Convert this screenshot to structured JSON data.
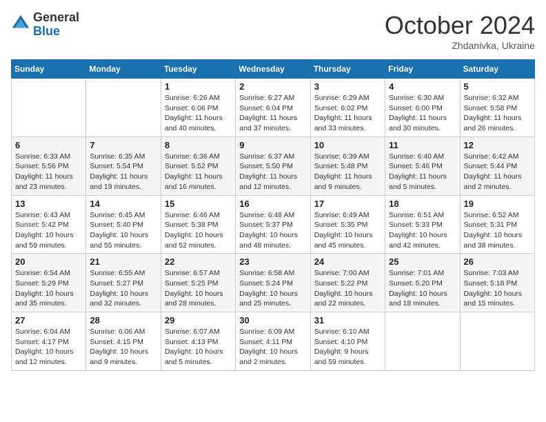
{
  "header": {
    "logo_general": "General",
    "logo_blue": "Blue",
    "month_title": "October 2024",
    "subtitle": "Zhdanivka, Ukraine"
  },
  "days_of_week": [
    "Sunday",
    "Monday",
    "Tuesday",
    "Wednesday",
    "Thursday",
    "Friday",
    "Saturday"
  ],
  "weeks": [
    [
      {
        "day": "",
        "sunrise": "",
        "sunset": "",
        "daylight": ""
      },
      {
        "day": "",
        "sunrise": "",
        "sunset": "",
        "daylight": ""
      },
      {
        "day": "1",
        "sunrise": "Sunrise: 6:26 AM",
        "sunset": "Sunset: 6:06 PM",
        "daylight": "Daylight: 11 hours and 40 minutes."
      },
      {
        "day": "2",
        "sunrise": "Sunrise: 6:27 AM",
        "sunset": "Sunset: 6:04 PM",
        "daylight": "Daylight: 11 hours and 37 minutes."
      },
      {
        "day": "3",
        "sunrise": "Sunrise: 6:29 AM",
        "sunset": "Sunset: 6:02 PM",
        "daylight": "Daylight: 11 hours and 33 minutes."
      },
      {
        "day": "4",
        "sunrise": "Sunrise: 6:30 AM",
        "sunset": "Sunset: 6:00 PM",
        "daylight": "Daylight: 11 hours and 30 minutes."
      },
      {
        "day": "5",
        "sunrise": "Sunrise: 6:32 AM",
        "sunset": "Sunset: 5:58 PM",
        "daylight": "Daylight: 11 hours and 26 minutes."
      }
    ],
    [
      {
        "day": "6",
        "sunrise": "Sunrise: 6:33 AM",
        "sunset": "Sunset: 5:56 PM",
        "daylight": "Daylight: 11 hours and 23 minutes."
      },
      {
        "day": "7",
        "sunrise": "Sunrise: 6:35 AM",
        "sunset": "Sunset: 5:54 PM",
        "daylight": "Daylight: 11 hours and 19 minutes."
      },
      {
        "day": "8",
        "sunrise": "Sunrise: 6:36 AM",
        "sunset": "Sunset: 5:52 PM",
        "daylight": "Daylight: 11 hours and 16 minutes."
      },
      {
        "day": "9",
        "sunrise": "Sunrise: 6:37 AM",
        "sunset": "Sunset: 5:50 PM",
        "daylight": "Daylight: 11 hours and 12 minutes."
      },
      {
        "day": "10",
        "sunrise": "Sunrise: 6:39 AM",
        "sunset": "Sunset: 5:48 PM",
        "daylight": "Daylight: 11 hours and 9 minutes."
      },
      {
        "day": "11",
        "sunrise": "Sunrise: 6:40 AM",
        "sunset": "Sunset: 5:46 PM",
        "daylight": "Daylight: 11 hours and 5 minutes."
      },
      {
        "day": "12",
        "sunrise": "Sunrise: 6:42 AM",
        "sunset": "Sunset: 5:44 PM",
        "daylight": "Daylight: 11 hours and 2 minutes."
      }
    ],
    [
      {
        "day": "13",
        "sunrise": "Sunrise: 6:43 AM",
        "sunset": "Sunset: 5:42 PM",
        "daylight": "Daylight: 10 hours and 59 minutes."
      },
      {
        "day": "14",
        "sunrise": "Sunrise: 6:45 AM",
        "sunset": "Sunset: 5:40 PM",
        "daylight": "Daylight: 10 hours and 55 minutes."
      },
      {
        "day": "15",
        "sunrise": "Sunrise: 6:46 AM",
        "sunset": "Sunset: 5:38 PM",
        "daylight": "Daylight: 10 hours and 52 minutes."
      },
      {
        "day": "16",
        "sunrise": "Sunrise: 6:48 AM",
        "sunset": "Sunset: 5:37 PM",
        "daylight": "Daylight: 10 hours and 48 minutes."
      },
      {
        "day": "17",
        "sunrise": "Sunrise: 6:49 AM",
        "sunset": "Sunset: 5:35 PM",
        "daylight": "Daylight: 10 hours and 45 minutes."
      },
      {
        "day": "18",
        "sunrise": "Sunrise: 6:51 AM",
        "sunset": "Sunset: 5:33 PM",
        "daylight": "Daylight: 10 hours and 42 minutes."
      },
      {
        "day": "19",
        "sunrise": "Sunrise: 6:52 AM",
        "sunset": "Sunset: 5:31 PM",
        "daylight": "Daylight: 10 hours and 38 minutes."
      }
    ],
    [
      {
        "day": "20",
        "sunrise": "Sunrise: 6:54 AM",
        "sunset": "Sunset: 5:29 PM",
        "daylight": "Daylight: 10 hours and 35 minutes."
      },
      {
        "day": "21",
        "sunrise": "Sunrise: 6:55 AM",
        "sunset": "Sunset: 5:27 PM",
        "daylight": "Daylight: 10 hours and 32 minutes."
      },
      {
        "day": "22",
        "sunrise": "Sunrise: 6:57 AM",
        "sunset": "Sunset: 5:25 PM",
        "daylight": "Daylight: 10 hours and 28 minutes."
      },
      {
        "day": "23",
        "sunrise": "Sunrise: 6:58 AM",
        "sunset": "Sunset: 5:24 PM",
        "daylight": "Daylight: 10 hours and 25 minutes."
      },
      {
        "day": "24",
        "sunrise": "Sunrise: 7:00 AM",
        "sunset": "Sunset: 5:22 PM",
        "daylight": "Daylight: 10 hours and 22 minutes."
      },
      {
        "day": "25",
        "sunrise": "Sunrise: 7:01 AM",
        "sunset": "Sunset: 5:20 PM",
        "daylight": "Daylight: 10 hours and 18 minutes."
      },
      {
        "day": "26",
        "sunrise": "Sunrise: 7:03 AM",
        "sunset": "Sunset: 5:18 PM",
        "daylight": "Daylight: 10 hours and 15 minutes."
      }
    ],
    [
      {
        "day": "27",
        "sunrise": "Sunrise: 6:04 AM",
        "sunset": "Sunset: 4:17 PM",
        "daylight": "Daylight: 10 hours and 12 minutes."
      },
      {
        "day": "28",
        "sunrise": "Sunrise: 6:06 AM",
        "sunset": "Sunset: 4:15 PM",
        "daylight": "Daylight: 10 hours and 9 minutes."
      },
      {
        "day": "29",
        "sunrise": "Sunrise: 6:07 AM",
        "sunset": "Sunset: 4:13 PM",
        "daylight": "Daylight: 10 hours and 5 minutes."
      },
      {
        "day": "30",
        "sunrise": "Sunrise: 6:09 AM",
        "sunset": "Sunset: 4:11 PM",
        "daylight": "Daylight: 10 hours and 2 minutes."
      },
      {
        "day": "31",
        "sunrise": "Sunrise: 6:10 AM",
        "sunset": "Sunset: 4:10 PM",
        "daylight": "Daylight: 9 hours and 59 minutes."
      },
      {
        "day": "",
        "sunrise": "",
        "sunset": "",
        "daylight": ""
      },
      {
        "day": "",
        "sunrise": "",
        "sunset": "",
        "daylight": ""
      }
    ]
  ]
}
